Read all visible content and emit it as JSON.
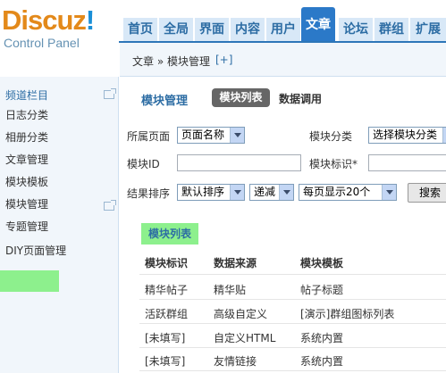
{
  "app": {
    "brand": "Discuz",
    "brand_mark": "!",
    "subtitle": "Control Panel"
  },
  "nav": {
    "tabs": [
      "首页",
      "全局",
      "界面",
      "内容",
      "用户",
      "文章",
      "论坛",
      "群组",
      "扩展"
    ],
    "active": "文章"
  },
  "breadcrumb": {
    "path": "文章 » 模块管理",
    "plus": "[+]"
  },
  "sidebar": {
    "header": "频道栏目",
    "items": [
      "日志分类",
      "相册分类",
      "文章管理",
      "模块模板",
      "模块管理",
      "专题管理",
      "DIY页面管理"
    ],
    "active": "模块管理"
  },
  "page": {
    "title": "模块管理",
    "tab_active": "模块列表",
    "tab_other": "数据调用"
  },
  "filters": {
    "page_label": "所属页面",
    "page_value": "页面名称",
    "category_label": "模块分类",
    "category_value": "选择模块分类",
    "id_label": "模块ID",
    "id_value": "",
    "tag_label": "模块标识*",
    "tag_value": "",
    "sort_label": "结果排序",
    "sort_value": "默认排序",
    "order_value": "递减",
    "perpage_value": "每页显示20个",
    "search_button": "搜索"
  },
  "list": {
    "title": "模块列表",
    "headers": [
      "模块标识",
      "数据来源",
      "模块模板"
    ],
    "rows": [
      [
        "精华帖子",
        "精华贴",
        "帖子标题"
      ],
      [
        "活跃群组",
        "高级自定义",
        "[演示]群组图标列表"
      ],
      [
        "[未填写]",
        "自定义HTML",
        "系统内置"
      ],
      [
        "[未填写]",
        "友情链接",
        "系统内置"
      ]
    ]
  },
  "colors": {
    "accent": "#2b79c8",
    "highlight": "#8df08d",
    "link": "#2d6da4",
    "logo_orange": "#e3891a"
  }
}
